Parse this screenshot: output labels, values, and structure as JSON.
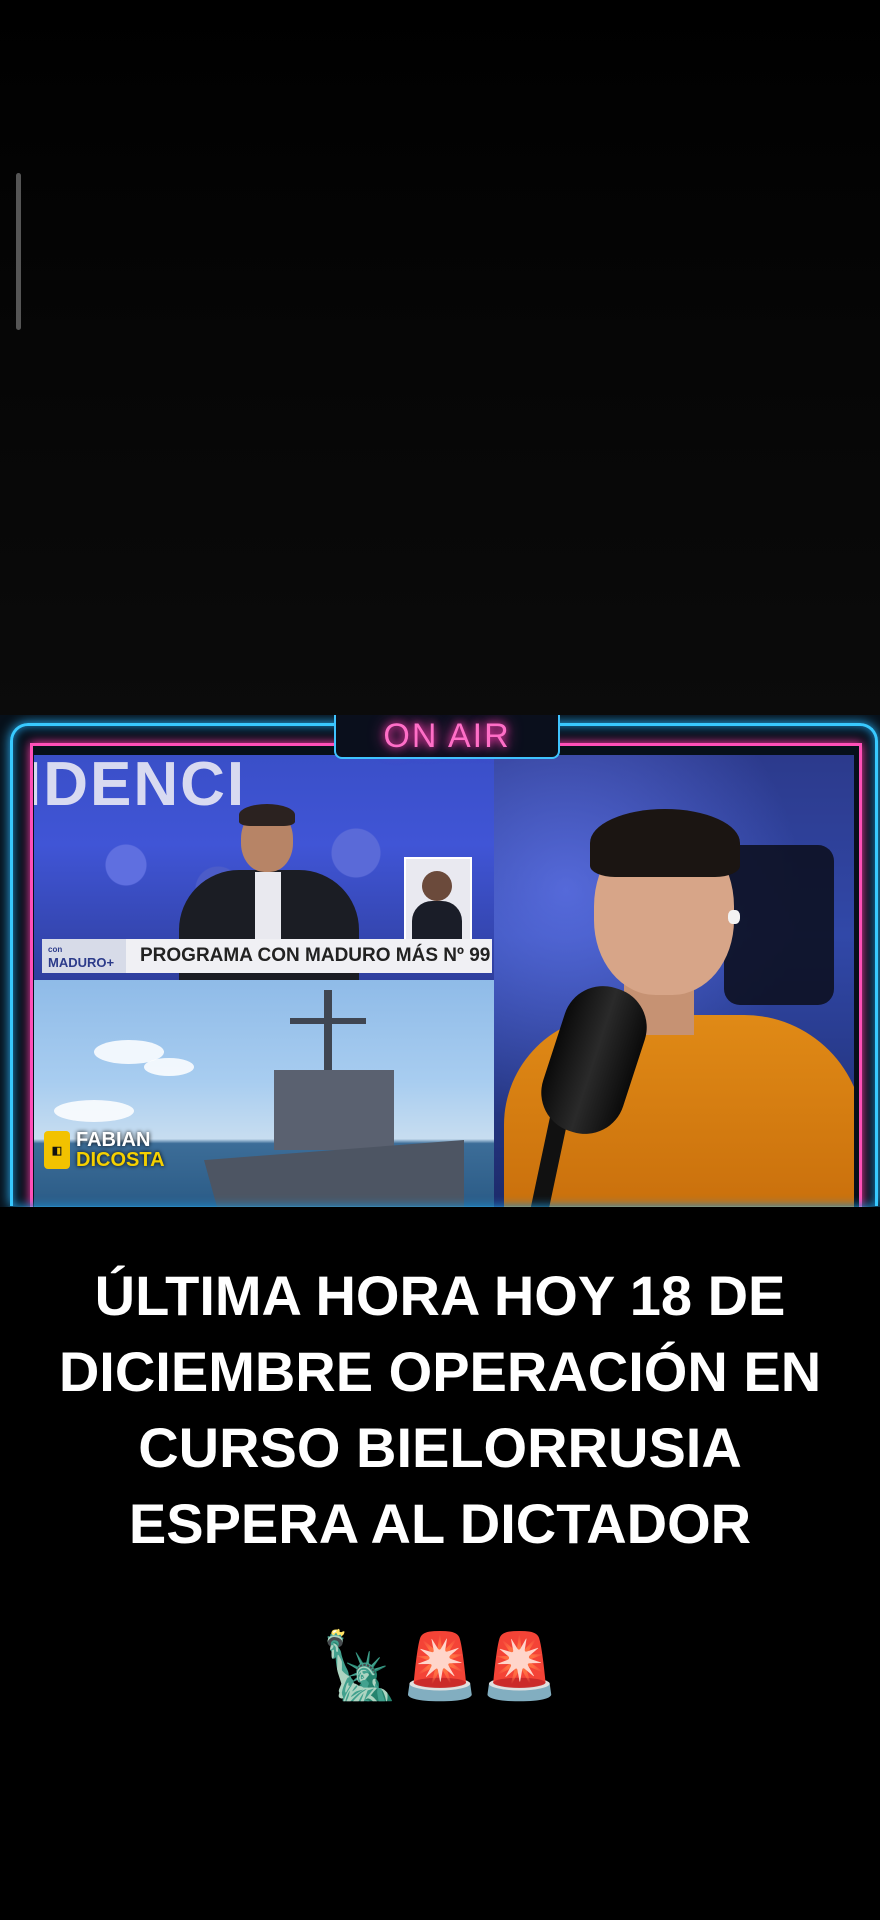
{
  "video": {
    "on_air_sign": "ON AIR",
    "left_panel": {
      "banner_fragment": "IDENCI",
      "lower_third": {
        "brand_small": "con",
        "brand": "MADURO+",
        "title": "PROGRAMA CON MADURO MÁS Nº 99"
      },
      "channel_logo": {
        "line1": "FABIAN",
        "line2": "DICOSTA"
      }
    }
  },
  "caption": {
    "text": "ÚLTIMA HORA HOY 18 DE DICIEMBRE OPERACIÓN EN CURSO BIELORRUSIA ESPERA AL DICTADOR",
    "emojis": "🗽🚨🚨"
  }
}
